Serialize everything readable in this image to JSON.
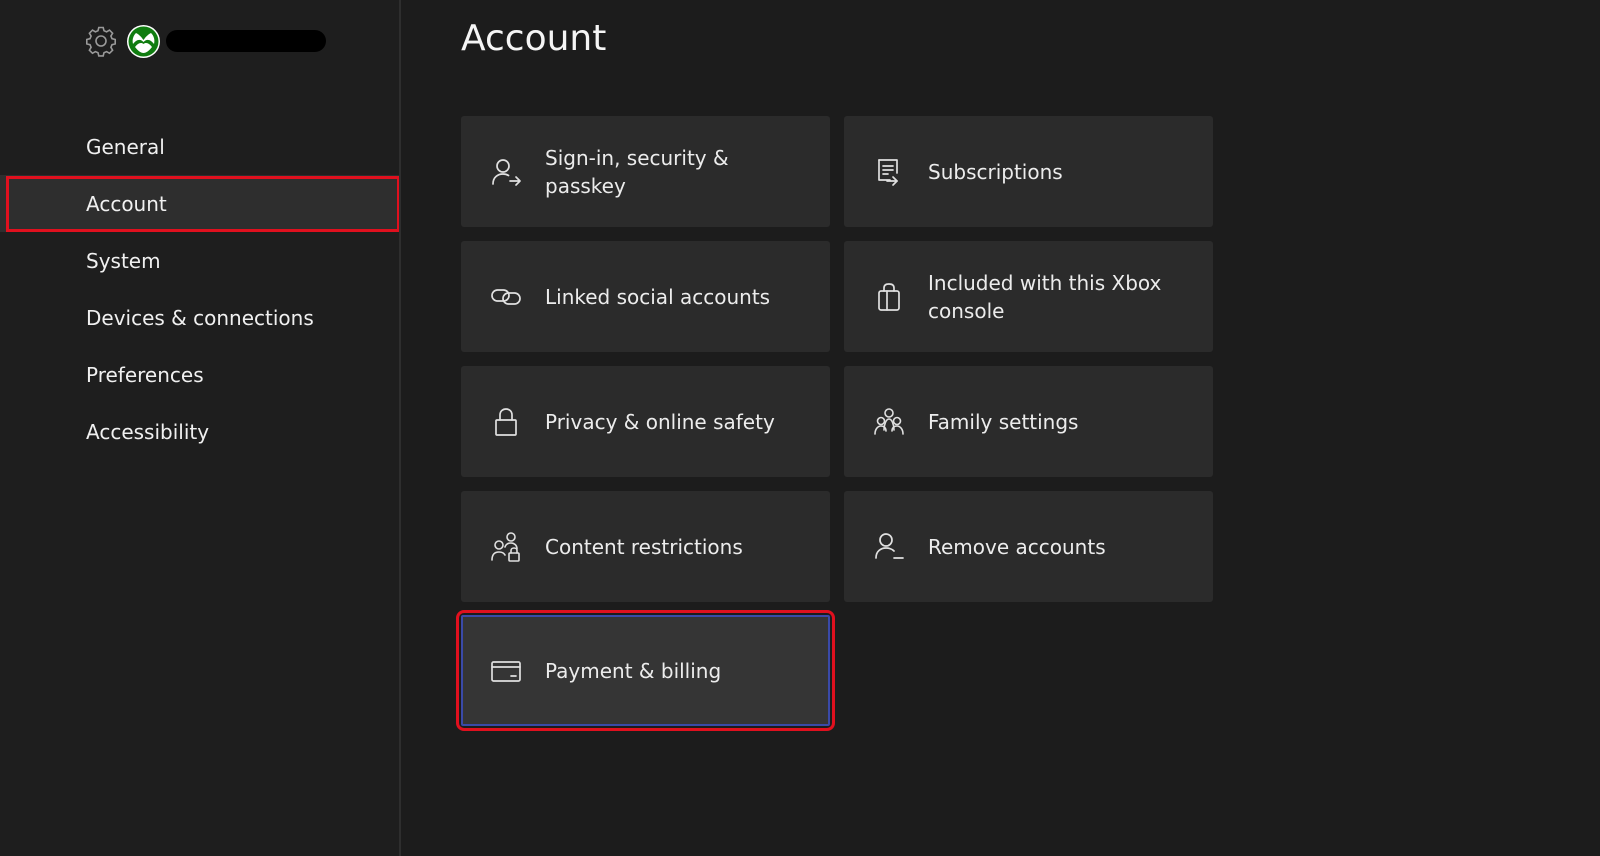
{
  "sidebar": {
    "items": [
      {
        "label": "General"
      },
      {
        "label": "Account"
      },
      {
        "label": "System"
      },
      {
        "label": "Devices & connections"
      },
      {
        "label": "Preferences"
      },
      {
        "label": "Accessibility"
      }
    ],
    "selected": "Account"
  },
  "header": {
    "icons": [
      "gear-icon",
      "xbox-logo"
    ],
    "gamertag": ""
  },
  "main": {
    "title": "Account",
    "tiles": [
      {
        "label": "Sign-in, security & passkey",
        "icon": "person-arrow-icon"
      },
      {
        "label": "Subscriptions",
        "icon": "document-arrow-icon"
      },
      {
        "label": "Linked social accounts",
        "icon": "link-icon"
      },
      {
        "label": "Included with this Xbox console",
        "icon": "shopping-bag-icon"
      },
      {
        "label": "Privacy & online safety",
        "icon": "lock-icon"
      },
      {
        "label": "Family settings",
        "icon": "family-icon"
      },
      {
        "label": "Content restrictions",
        "icon": "people-lock-icon"
      },
      {
        "label": "Remove accounts",
        "icon": "person-minus-icon"
      },
      {
        "label": "Payment & billing",
        "icon": "credit-card-icon"
      }
    ],
    "focused": "Payment & billing"
  },
  "colors": {
    "background": "#1c1c1c",
    "tile": "#2b2b2b",
    "highlight": "#e0101e",
    "xbox_green": "#107c10"
  }
}
